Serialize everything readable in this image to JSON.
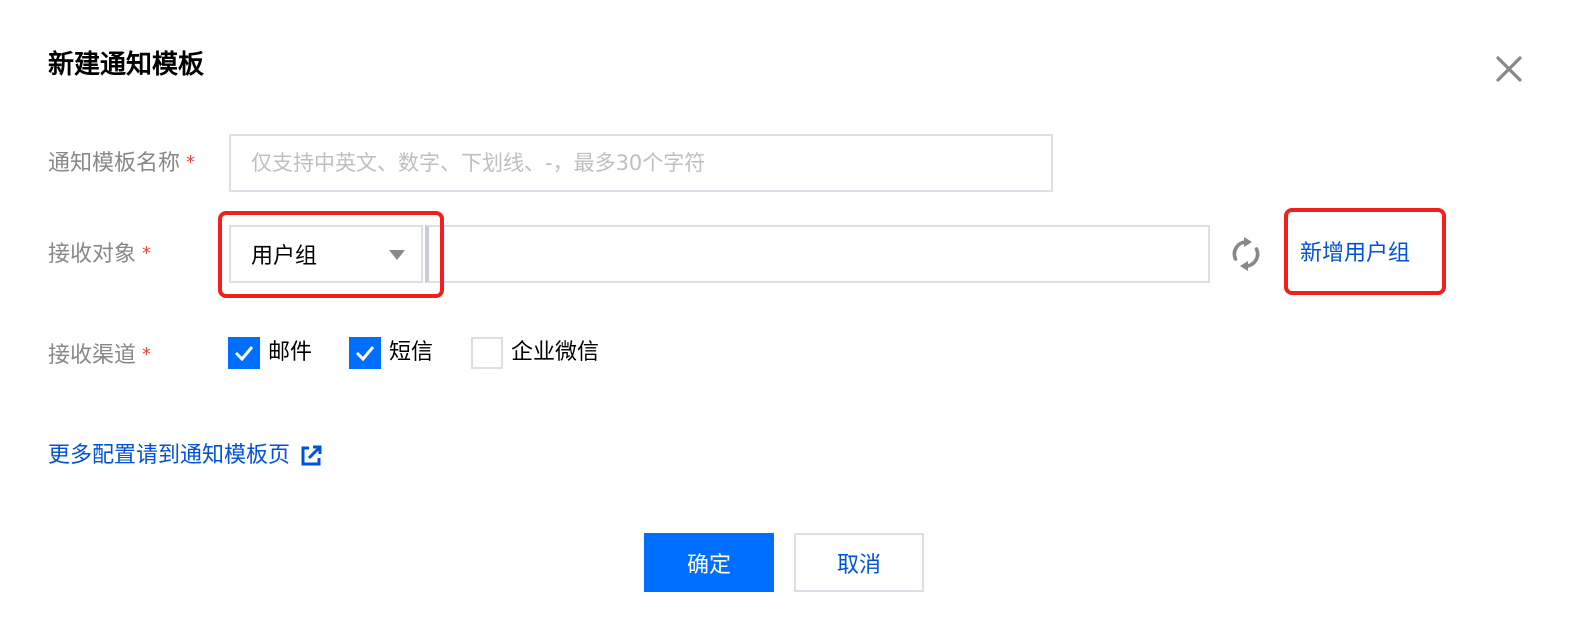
{
  "dialog": {
    "title": "新建通知模板"
  },
  "form": {
    "name": {
      "label": "通知模板名称",
      "required_mark": "*",
      "placeholder": "仅支持中英文、数字、下划线、-，最多30个字符",
      "value": ""
    },
    "receiver": {
      "label": "接收对象",
      "required_mark": "*",
      "type_selected": "用户组",
      "value": "",
      "add_link": "新增用户组"
    },
    "channels": {
      "label": "接收渠道",
      "required_mark": "*",
      "options": [
        {
          "label": "邮件",
          "checked": true
        },
        {
          "label": "短信",
          "checked": true
        },
        {
          "label": "企业微信",
          "checked": false
        }
      ]
    }
  },
  "more_config_link": "更多配置请到通知模板页",
  "footer": {
    "ok_label": "确定",
    "cancel_label": "取消"
  },
  "colors": {
    "primary": "#006eff",
    "link": "#0052d9",
    "required": "#e54545",
    "highlight": "#f0201a"
  },
  "icons": {
    "close": "close-icon",
    "select_caret": "caret-down-icon",
    "refresh": "refresh-icon",
    "external": "external-link-icon",
    "check": "check-icon"
  }
}
